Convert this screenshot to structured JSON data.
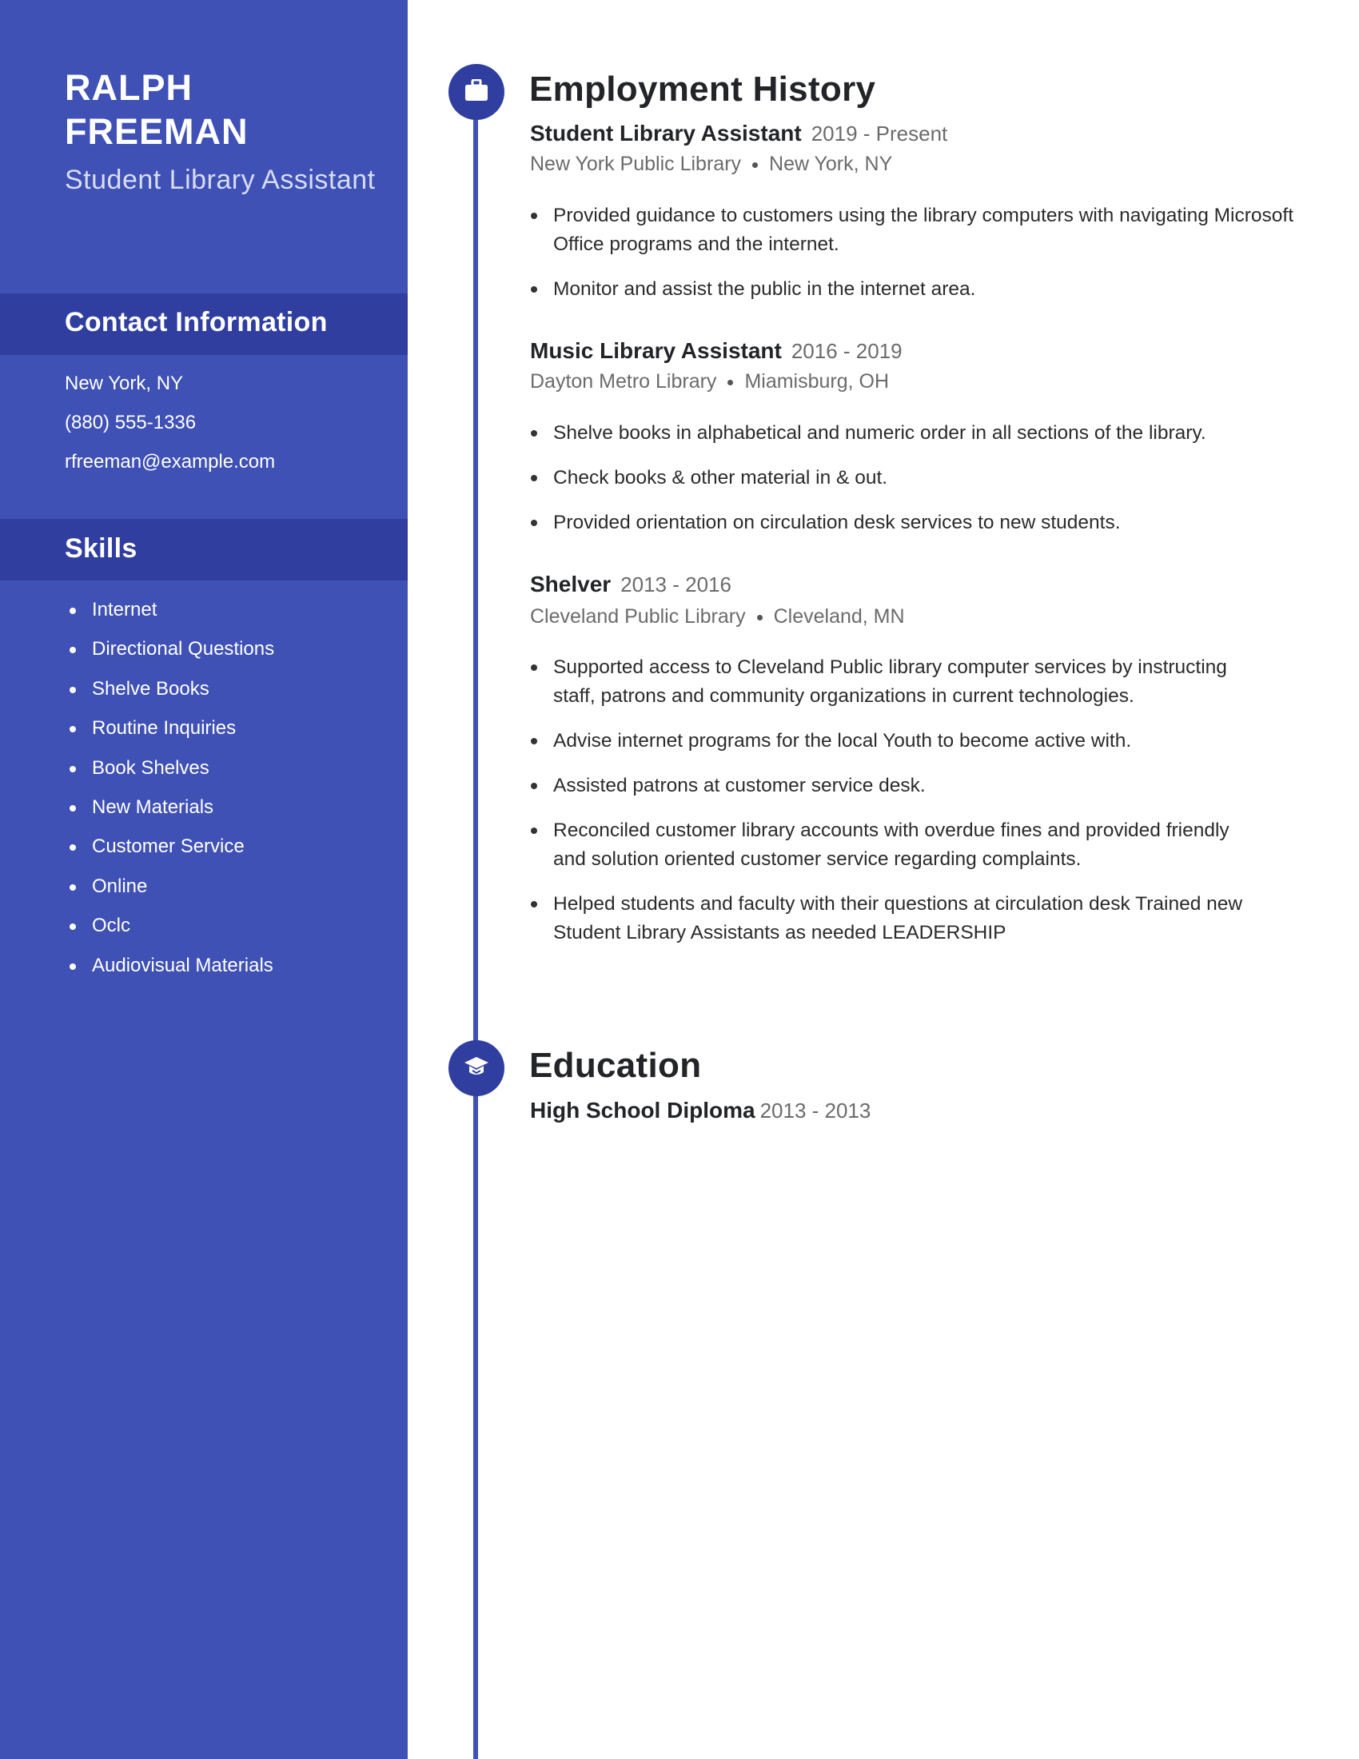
{
  "profile": {
    "first_name": "RALPH",
    "last_name": "FREEMAN",
    "title": "Student Library Assistant"
  },
  "contact": {
    "heading": "Contact Information",
    "location": "New York, NY",
    "phone": "(880) 555-1336",
    "email": "rfreeman@example.com"
  },
  "skills": {
    "heading": "Skills",
    "items": [
      "Internet",
      "Directional Questions",
      "Shelve Books",
      "Routine Inquiries",
      "Book Shelves",
      "New Materials",
      "Customer Service",
      "Online",
      "Oclc",
      "Audiovisual Materials"
    ]
  },
  "employment": {
    "heading": "Employment History",
    "icon": "briefcase-icon",
    "jobs": [
      {
        "title": "Student Library Assistant",
        "dates": "2019 - Present",
        "employer": "New York Public Library",
        "location": "New York, NY",
        "bullets": [
          "Provided guidance to customers using the library computers with navigating Microsoft Office programs and the internet.",
          "Monitor and assist the public in the internet area."
        ]
      },
      {
        "title": "Music Library Assistant",
        "dates": "2016 - 2019",
        "employer": "Dayton Metro Library",
        "location": "Miamisburg, OH",
        "bullets": [
          "Shelve books in alphabetical and numeric order in all sections of the library.",
          "Check books & other material in & out.",
          "Provided orientation on circulation desk services to new students."
        ]
      },
      {
        "title": "Shelver",
        "dates": "2013 - 2016",
        "employer": "Cleveland Public Library",
        "location": "Cleveland, MN",
        "bullets": [
          "Supported access to Cleveland Public library computer services by instructing staff, patrons and community organizations in current technologies.",
          "Advise internet programs for the local Youth to become active with.",
          "Assisted patrons at customer service desk.",
          "Reconciled customer library accounts with overdue fines and provided friendly and solution oriented customer service regarding complaints.",
          "Helped students and faculty with their questions at circulation desk Trained new Student Library Assistants as needed LEADERSHIP"
        ]
      }
    ]
  },
  "education": {
    "heading": "Education",
    "icon": "graduation-cap-icon",
    "entries": [
      {
        "degree": "High School Diploma",
        "dates": "2013 - 2013"
      }
    ]
  },
  "colors": {
    "sidebar": "#3f51b5",
    "sidebar_band": "#303f9f",
    "timeline": "#3f51b5",
    "node": "#303f9f",
    "text_dark": "#222428",
    "text_muted": "#6b6b6b"
  }
}
